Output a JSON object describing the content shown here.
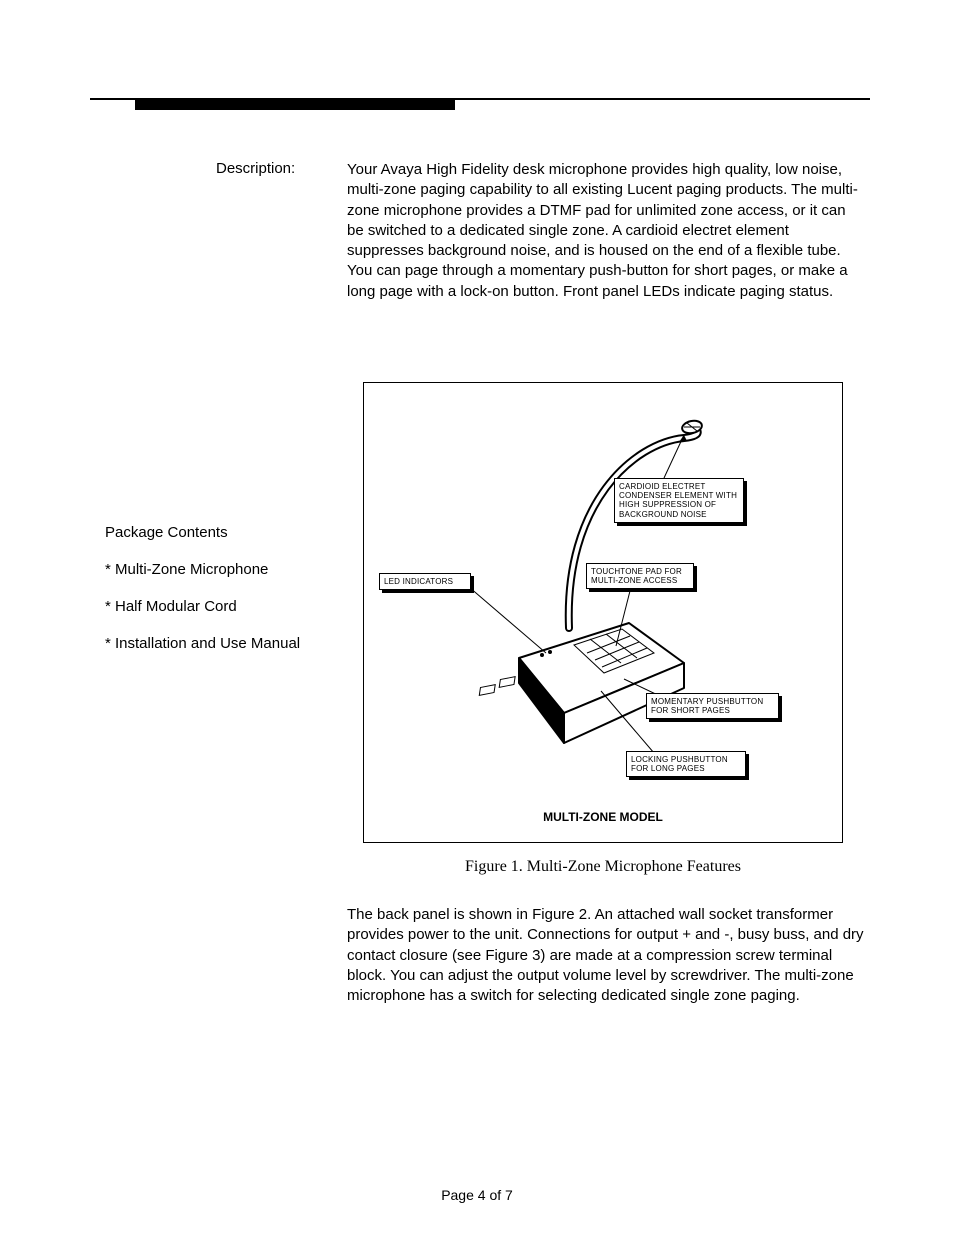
{
  "description_label": "Description:",
  "description_body": "Your Avaya High Fidelity desk microphone provides high quality, low noise, multi-zone paging capability to all existing Lucent paging products. The multi-zone microphone provides a DTMF pad for unlimited zone access, or it can be switched to a dedicated single zone. A cardioid electret element suppresses background noise, and is housed on the end of a flexible tube. You can page through a momentary push-button for short pages, or make a long page with a lock-on button. Front panel LEDs indicate paging status.",
  "package_contents": {
    "heading": "Package Contents",
    "items": [
      "* Multi-Zone Microphone",
      "* Half Modular Cord",
      "* Installation and Use Manual"
    ]
  },
  "figure": {
    "callouts": {
      "cardioid": "CARDIOID ELECTRET CONDENSER ELEMENT WITH HIGH SUPPRESSION OF BACKGROUND NOISE",
      "led": "LED INDICATORS",
      "touchtone": "TOUCHTONE PAD FOR MULTI-ZONE ACCESS",
      "momentary": "MOMENTARY PUSHBUTTON FOR SHORT PAGES",
      "locking": "LOCKING PUSHBUTTON FOR LONG PAGES"
    },
    "model_label": "MULTI-ZONE MODEL",
    "caption_prefix": "Figure 1.",
    "caption_text": " Multi-Zone Microphone Features"
  },
  "paragraph2": "The back panel is shown in Figure 2. An attached wall socket transformer provides power to the unit. Connections for output + and -, busy buss, and dry contact closure (see Figure 3) are made at a compression screw terminal block. You can adjust the output volume level by screwdriver. The multi-zone microphone has a switch for selecting dedicated single zone paging.",
  "footer": "Page 4 of 7"
}
